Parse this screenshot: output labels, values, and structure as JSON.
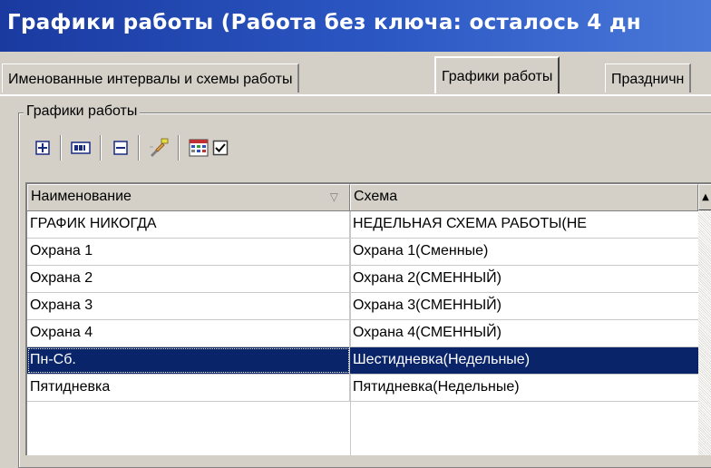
{
  "window": {
    "title": "Графики работы (Работа без ключа: осталось 4 дн"
  },
  "tabs": [
    {
      "label": "Именованные интервалы и схемы работы"
    },
    {
      "label": "Графики работы",
      "active": true
    },
    {
      "label": "Праздничн"
    }
  ],
  "group": {
    "title": "Графики работы"
  },
  "toolbar": {
    "buttons": [
      {
        "icon": "add-record-icon"
      },
      {
        "icon": "rename-icon"
      },
      {
        "icon": "delete-record-icon"
      },
      {
        "icon": "edit-properties-icon"
      },
      {
        "icon": "calendar-grid-icon"
      },
      {
        "icon": "checkbox-icon",
        "checked": true
      }
    ]
  },
  "grid": {
    "columns": [
      "Наименование",
      "Схема"
    ],
    "rows": [
      {
        "name": " ГРАФИК НИКОГДА",
        "scheme": " НЕДЕЛЬНАЯ СХЕМА РАБОТЫ(НЕ"
      },
      {
        "name": "Охрана 1",
        "scheme": "Охрана 1(Сменные)"
      },
      {
        "name": "Охрана 2",
        "scheme": "Охрана 2(СМЕННЫЙ)"
      },
      {
        "name": "Охрана 3",
        "scheme": "Охрана 3(СМЕННЫЙ)"
      },
      {
        "name": "Охрана 4",
        "scheme": "Охрана 4(СМЕННЫЙ)"
      },
      {
        "name": "Пн-Сб.",
        "scheme": "Шестидневка(Недельные)",
        "selected": true
      },
      {
        "name": "Пятидневка",
        "scheme": "Пятидневка(Недельные)"
      }
    ]
  },
  "colors": {
    "title_bar": "#2c58c4",
    "selection": "#0a246a",
    "face": "#d4d0c8"
  }
}
